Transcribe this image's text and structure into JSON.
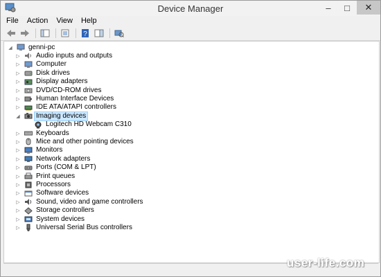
{
  "window": {
    "title": "Device Manager",
    "icon": "device-manager-icon",
    "controls": {
      "minimize": "–",
      "maximize": "□",
      "close": "✕"
    }
  },
  "menu": [
    "File",
    "Action",
    "View",
    "Help"
  ],
  "toolbar": [
    "back-icon",
    "forward-icon",
    "properties-icon",
    "show-hide-console-tree-icon",
    "help-icon",
    "action-pane-icon",
    "scan-hardware-icon"
  ],
  "tree": {
    "root": "genni-pc",
    "categories": [
      {
        "label": "Audio inputs and outputs",
        "icon": "speaker-icon"
      },
      {
        "label": "Computer",
        "icon": "computer-icon"
      },
      {
        "label": "Disk drives",
        "icon": "disk-drive-icon"
      },
      {
        "label": "Display adapters",
        "icon": "display-adapter-icon"
      },
      {
        "label": "DVD/CD-ROM drives",
        "icon": "dvd-drive-icon"
      },
      {
        "label": "Human Interface Devices",
        "icon": "hid-icon"
      },
      {
        "label": "IDE ATA/ATAPI controllers",
        "icon": "ide-controller-icon"
      },
      {
        "label": "Imaging devices",
        "icon": "imaging-device-icon",
        "expanded": true,
        "selected": true,
        "children": [
          {
            "label": "Logitech HD Webcam C310",
            "icon": "webcam-icon"
          }
        ]
      },
      {
        "label": "Keyboards",
        "icon": "keyboard-icon"
      },
      {
        "label": "Mice and other pointing devices",
        "icon": "mouse-icon"
      },
      {
        "label": "Monitors",
        "icon": "monitor-icon"
      },
      {
        "label": "Network adapters",
        "icon": "network-adapter-icon"
      },
      {
        "label": "Ports (COM & LPT)",
        "icon": "port-icon"
      },
      {
        "label": "Print queues",
        "icon": "printer-icon"
      },
      {
        "label": "Processors",
        "icon": "processor-icon"
      },
      {
        "label": "Software devices",
        "icon": "software-device-icon"
      },
      {
        "label": "Sound, video and game controllers",
        "icon": "sound-controller-icon"
      },
      {
        "label": "Storage controllers",
        "icon": "storage-controller-icon"
      },
      {
        "label": "System devices",
        "icon": "system-device-icon"
      },
      {
        "label": "Universal Serial Bus controllers",
        "icon": "usb-icon"
      }
    ]
  },
  "watermark": "user-life.com"
}
